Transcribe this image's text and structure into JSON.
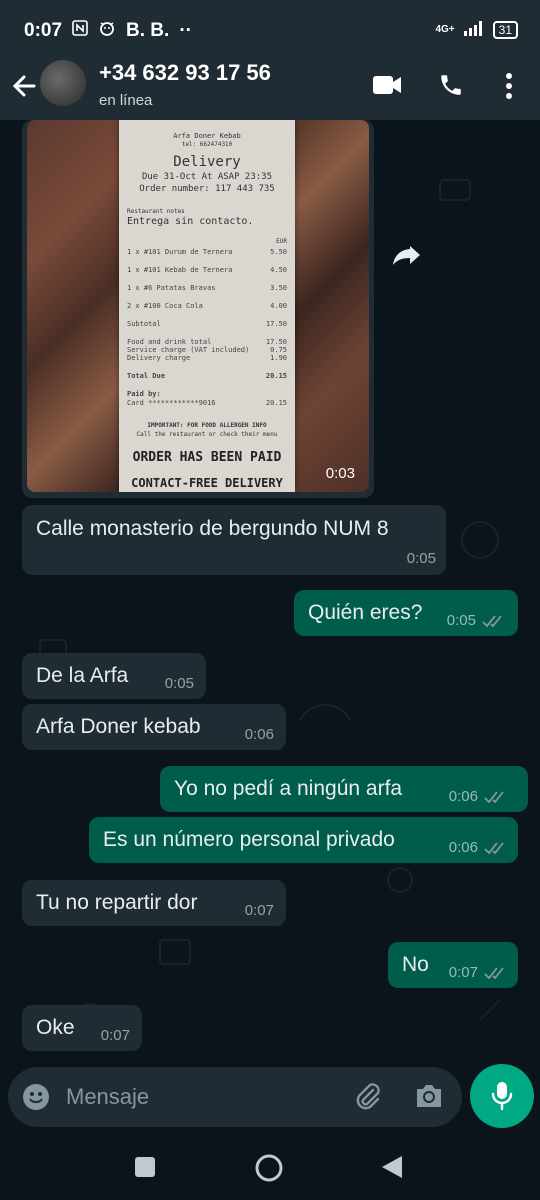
{
  "status": {
    "time": "0:07",
    "carrier": "B. B.",
    "dots": "··",
    "network": "4G+",
    "battery": "31"
  },
  "header": {
    "contact_name": "+34 632 93 17 56",
    "contact_status": "en línea",
    "icons": [
      "back-arrow-icon",
      "video-call-icon",
      "phone-icon",
      "more-vert-icon"
    ]
  },
  "image_message": {
    "time": "0:03",
    "receipt": {
      "restaurant": "Arfa Doner Kebab",
      "phone": "tel: 662474310",
      "title": "Delivery",
      "due": "Due 31-Oct At ASAP 23:35",
      "order": "Order number: 117 443 735",
      "notes_label": "Restaurant notes",
      "notes": "Entrega sin contacto.",
      "currency": "EUR",
      "items": [
        {
          "name": "1 x #101 Durum de Ternera",
          "price": "5.50"
        },
        {
          "name": "1 x #101 Kebab de Ternera",
          "price": "4.50"
        },
        {
          "name": "1 x #6 Patatas Bravas",
          "price": "3.50"
        },
        {
          "name": "2 x #100 Coca Cola",
          "price": "4.00"
        },
        {
          "name": "Subtotal",
          "price": "17.50"
        },
        {
          "name": "Food and drink total",
          "price": "17.50"
        },
        {
          "name": "Service charge (VAT included)",
          "price": "0.75"
        },
        {
          "name": "Delivery charge",
          "price": "1.90"
        },
        {
          "name": "Total Due",
          "price": "20.15"
        },
        {
          "name": "Paid by:",
          "price": ""
        },
        {
          "name": "Card ************9016",
          "price": "20.15"
        }
      ],
      "allergen": "IMPORTANT: FOR FOOD ALLERGEN INFO",
      "allergen2": "Call the restaurant or check their menu",
      "paid": "ORDER HAS BEEN PAID",
      "contactless": "CONTACT-FREE DELIVERY"
    }
  },
  "messages": [
    {
      "dir": "in",
      "text": "Calle monasterio de bergundo NUM 8",
      "time": "0:05"
    },
    {
      "dir": "out",
      "text": "Quién eres?",
      "time": "0:05"
    },
    {
      "dir": "in",
      "text": "De la Arfa",
      "time": "0:05"
    },
    {
      "dir": "in",
      "text": "Arfa Doner kebab",
      "time": "0:06"
    },
    {
      "dir": "out",
      "text": "Yo no pedí a ningún arfa",
      "time": "0:06"
    },
    {
      "dir": "out",
      "text": "Es un número personal privado",
      "time": "0:06"
    },
    {
      "dir": "in",
      "text": "Tu no repartir dor",
      "time": "0:07"
    },
    {
      "dir": "out",
      "text": "No",
      "time": "0:07"
    },
    {
      "dir": "in",
      "text": "Oke",
      "time": "0:07"
    }
  ],
  "input": {
    "placeholder": "Mensaje"
  },
  "colors": {
    "header": "#1f2c34",
    "background": "#0b141a",
    "incoming": "#1f2c34",
    "outgoing": "#005c4b",
    "accent": "#00a884",
    "ticks": "#8696a0"
  }
}
